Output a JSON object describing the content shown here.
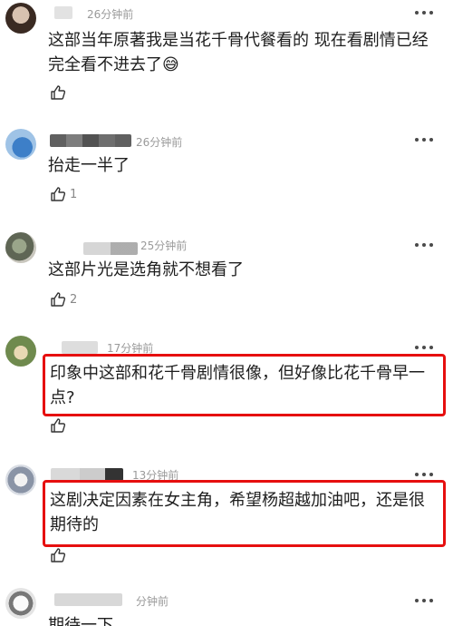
{
  "comments": [
    {
      "time": "26分钟前",
      "text": "这部当年原著我是当花千骨代餐看的 现在看剧情已经完全看不进去了😅",
      "likes": ""
    },
    {
      "time": "26分钟前",
      "text": "抬走一半了",
      "likes": "1"
    },
    {
      "time": "25分钟前",
      "text": "这部片光是选角就不想看了",
      "likes": "2"
    },
    {
      "time": "17分钟前",
      "text": "印象中这部和花千骨剧情很像，但好像比花千骨早一点?",
      "likes": ""
    },
    {
      "time": "13分钟前",
      "text": "这剧决定因素在女主角，希望杨超越加油吧，还是很期待的",
      "likes": ""
    },
    {
      "time": "分钟前",
      "text": "期待一下",
      "likes": ""
    }
  ],
  "colors": {
    "highlight": "#e60f0f",
    "text": "#1e1e1e",
    "meta": "#9a9a9a"
  },
  "icons": {
    "more": "more-dots-icon",
    "like": "thumbs-up-icon"
  }
}
